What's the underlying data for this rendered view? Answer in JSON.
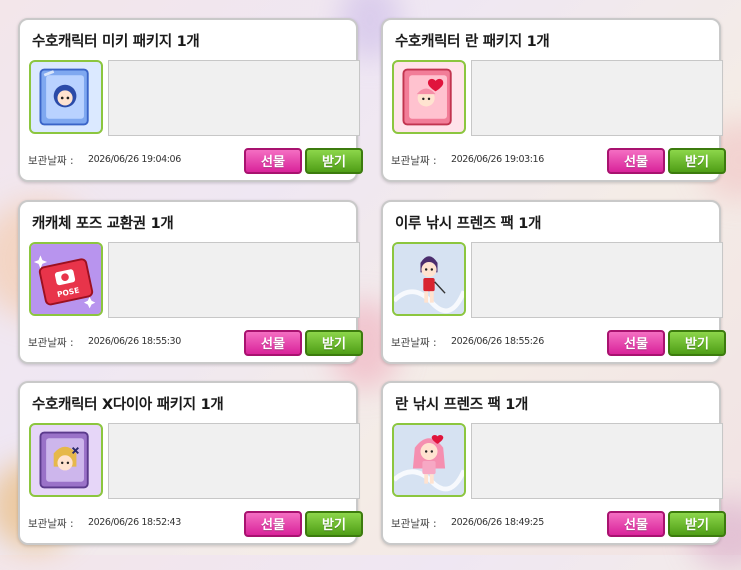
{
  "items": [
    {
      "title": "수호캐릭터 미키 패키지 1개",
      "icon": "blue-package-icon",
      "date_label": "보관날짜 :",
      "date": "2026/06/26 19:04:06",
      "gift_label": "선물",
      "receive_label": "받기"
    },
    {
      "title": "수호캐릭터 란 패키지 1개",
      "icon": "pink-heart-package-icon",
      "date_label": "보관날짜 :",
      "date": "2026/06/26 19:03:16",
      "gift_label": "선물",
      "receive_label": "받기"
    },
    {
      "title": "캐캐체 포즈 교환권 1개",
      "icon": "pose-ticket-icon",
      "date_label": "보관날짜 :",
      "date": "2026/06/26 18:55:30",
      "gift_label": "선물",
      "receive_label": "받기"
    },
    {
      "title": "이루 낚시 프렌즈 팩 1개",
      "icon": "iru-character-icon",
      "date_label": "보관날짜 :",
      "date": "2026/06/26 18:55:26",
      "gift_label": "선물",
      "receive_label": "받기"
    },
    {
      "title": "수호캐릭터 X다이아 패키지 1개",
      "icon": "purple-package-icon",
      "date_label": "보관날짜 :",
      "date": "2026/06/26 18:52:43",
      "gift_label": "선물",
      "receive_label": "받기"
    },
    {
      "title": "란 낚시 프렌즈 팩 1개",
      "icon": "ran-character-icon",
      "date_label": "보관날짜 :",
      "date": "2026/06/26 18:49:25",
      "gift_label": "선물",
      "receive_label": "받기"
    }
  ]
}
